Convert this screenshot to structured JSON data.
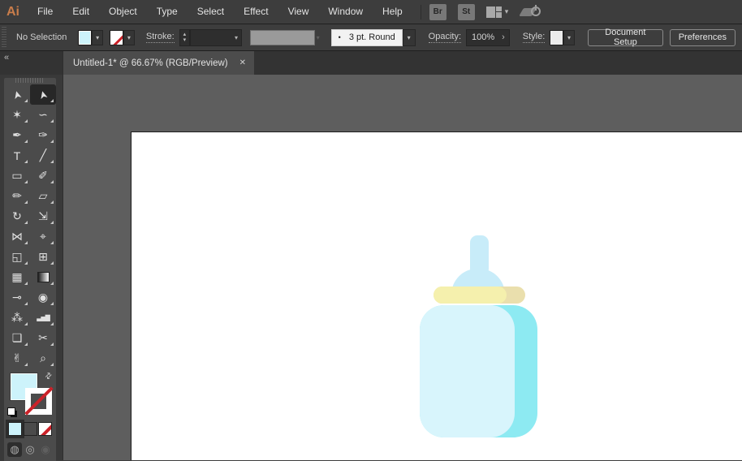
{
  "colors": {
    "chrome": "#3d3d3d",
    "chrome_dark": "#2b2b2b",
    "line": "#1f1f1f",
    "tabbar": "#333333",
    "tab_active": "#4c4c4c",
    "dock": "#393939",
    "panel": "#4b4b4b",
    "panel_icon": "#e0e0e0",
    "active_tool_bg": "#272727",
    "canvas": "#5e5e5e",
    "artboard": "#ffffff",
    "field": "#2e2e2e",
    "field_border": "#242424",
    "text": "#e3e3e3",
    "text_dim": "#cfcfcf",
    "logo": "#c97d4b",
    "accent_fill": "#cdf3fb",
    "red": "#cc2229",
    "btn_border": "#8a8a8a",
    "disabled_fill": "#9a9a9a",
    "bottle_body": "#d8f5fc",
    "bottle_shade": "#8deaf2",
    "cap": "#f5f0ad",
    "cap_shade": "#eadfad",
    "nipple": "#c8ecf9"
  },
  "menubar": {
    "logo": "Ai",
    "items": [
      "File",
      "Edit",
      "Object",
      "Type",
      "Select",
      "Effect",
      "View",
      "Window",
      "Help"
    ],
    "bridge_button": "Br",
    "stock_button": "St"
  },
  "controlbar": {
    "no_selection": "No Selection",
    "stroke_label": "Stroke:",
    "brush_bullet": "•",
    "brush_value": "3 pt. Round",
    "opacity_label": "Opacity:",
    "opacity_value": "100%",
    "style_label": "Style:",
    "document_setup": "Document Setup",
    "preferences": "Preferences"
  },
  "ui": {
    "chevron": "▾",
    "chevron_right": "›",
    "stepper_up": "▴",
    "stepper_down": "▾"
  },
  "tabbar": {
    "title": "Untitled-1* @ 66.67% (RGB/Preview)",
    "close_glyph": "✕"
  },
  "toolbar": {
    "collapse_glyph": "«",
    "swap_glyph": "⇄",
    "tools": [
      {
        "name": "direct-selection-tool",
        "glyph": "➤",
        "rot": true
      },
      {
        "name": "selection-tool",
        "glyph": "➤",
        "rot": true,
        "active": true
      },
      {
        "name": "magic-wand-tool",
        "glyph": "✶"
      },
      {
        "name": "lasso-tool",
        "glyph": "∽"
      },
      {
        "name": "pen-tool",
        "glyph": "✒"
      },
      {
        "name": "curvature-tool",
        "glyph": "✑"
      },
      {
        "name": "type-tool",
        "glyph": "T"
      },
      {
        "name": "line-segment-tool",
        "glyph": "╱"
      },
      {
        "name": "rectangle-tool",
        "glyph": "▭"
      },
      {
        "name": "paintbrush-tool",
        "glyph": "✐"
      },
      {
        "name": "pencil-tool",
        "glyph": "✏"
      },
      {
        "name": "eraser-tool",
        "glyph": "▱"
      },
      {
        "name": "rotate-tool",
        "glyph": "↻"
      },
      {
        "name": "scale-tool",
        "glyph": "⇲"
      },
      {
        "name": "width-tool",
        "glyph": "⋈"
      },
      {
        "name": "puppet-warp-tool",
        "glyph": "⌖"
      },
      {
        "name": "shape-builder-tool",
        "glyph": "◱"
      },
      {
        "name": "perspective-grid-tool",
        "glyph": "⊞"
      },
      {
        "name": "mesh-tool",
        "glyph": "▦"
      },
      {
        "name": "gradient-tool",
        "glyph": "",
        "css": "gradient"
      },
      {
        "name": "eyedropper-tool",
        "glyph": "⊸"
      },
      {
        "name": "blend-tool",
        "glyph": "◉"
      },
      {
        "name": "symbol-sprayer-tool",
        "glyph": "⁂"
      },
      {
        "name": "column-graph-tool",
        "glyph": "▃▅▇",
        "small": true
      },
      {
        "name": "artboard-tool",
        "glyph": "❏"
      },
      {
        "name": "slice-tool",
        "glyph": "✂"
      },
      {
        "name": "hand-tool",
        "glyph": "✌"
      },
      {
        "name": "zoom-tool",
        "glyph": "⌕"
      }
    ],
    "swatch_buttons": [
      {
        "name": "color-button",
        "type": "color",
        "active": true
      },
      {
        "name": "gradient-button",
        "type": "gradient",
        "active": false
      },
      {
        "name": "none-button",
        "type": "none",
        "active": false
      }
    ],
    "draw_modes": [
      {
        "name": "draw-normal-mode",
        "glyph": "◍",
        "active": true
      },
      {
        "name": "draw-behind-mode",
        "glyph": "◎",
        "active": false
      },
      {
        "name": "draw-inside-mode",
        "glyph": "◉",
        "disabled": true
      }
    ]
  },
  "illustration": {
    "name": "baby-bottle",
    "parts": [
      "nipple-tip",
      "nipple-dome",
      "cap-shade",
      "cap-light",
      "body-shade",
      "body-light"
    ]
  }
}
